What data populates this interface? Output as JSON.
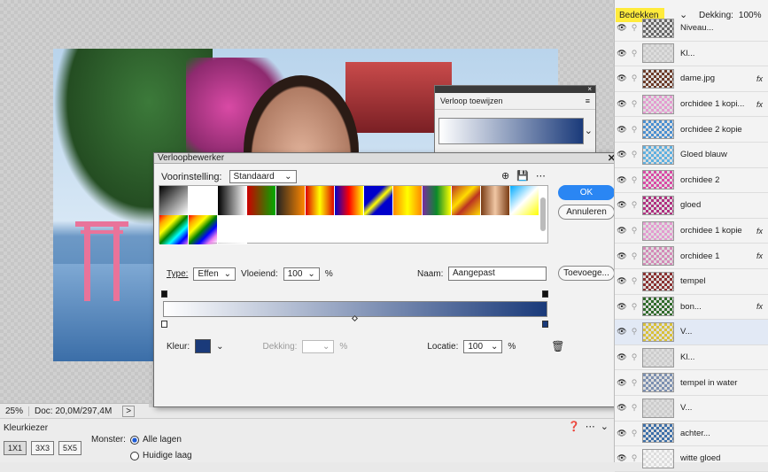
{
  "status": {
    "zoom": "25%",
    "doc": "Doc: 20,0M/297,4M",
    "arrow": ">"
  },
  "color_picker": {
    "title": "Kleurkiezer",
    "sizes": [
      "1X1",
      "3X3",
      "5X5"
    ],
    "monster_label": "Monster:",
    "options": [
      "Alle lagen",
      "Huidige laag"
    ]
  },
  "assign_panel": {
    "title": "Verloop toewijzen",
    "menu": "≡",
    "close": "×"
  },
  "dialog": {
    "title": "Verloopbewerker",
    "close": "✕",
    "preset_label": "Voorinstelling:",
    "preset_value": "Standaard",
    "ok": "OK",
    "cancel": "Annuleren",
    "add": "Toevoege...",
    "type_label": "Type:",
    "type_value": "Effen",
    "smooth_label": "Vloeiend:",
    "smooth_value": "100",
    "pct": "%",
    "name_label": "Naam:",
    "name_value": "Aangepast",
    "color_label": "Kleur:",
    "opacity_label": "Dekking:",
    "location_label": "Locatie:",
    "location_value": "100",
    "presets": [
      "linear-gradient(135deg,#000,#fff)",
      "linear-gradient(135deg,#ffffff,rgba(255,255,255,0))",
      "linear-gradient(to right,#000,#fff)",
      "linear-gradient(to right,#c00,#0a0)",
      "linear-gradient(to right,#222,#f80)",
      "linear-gradient(to right,#d00,#ff0,#d00)",
      "linear-gradient(to right,#00c,#f00,#ff0)",
      "linear-gradient(135deg,#00c 35%,#ff0 50%,#00c 65%)",
      "linear-gradient(to right,#f80,#ff0,#f80)",
      "linear-gradient(to right,#7a2ba1,#0a8a2a,#ff0)",
      "linear-gradient(135deg,#b32,#fd0 40%,#b32 60%,#fd0)",
      "linear-gradient(to right,#7a3c14,#f1c7a5,#7a3c14)",
      "linear-gradient(135deg,#0af,#fff 50%,#ff0)",
      "linear-gradient(135deg,red,orange,yellow,green,cyan,blue,violet)",
      "linear-gradient(135deg,red,orange,yellow,green,blue,violet,rgba(255,255,255,0))",
      "linear-gradient(135deg,rgba(255,255,255,0),#fff)"
    ],
    "swatch_color": "#1a3a7a"
  },
  "layers": {
    "blend_mode": "Bedekken",
    "opacity_label": "Dekking:",
    "opacity_value": "100%",
    "items": [
      {
        "name": "Niveau...",
        "fx": ""
      },
      {
        "name": "Kl...",
        "fx": ""
      },
      {
        "name": "dame.jpg",
        "fx": "fx"
      },
      {
        "name": "orchidee 1 kopi...",
        "fx": "fx"
      },
      {
        "name": "orchidee 2 kopie",
        "fx": ""
      },
      {
        "name": "Gloed blauw",
        "fx": ""
      },
      {
        "name": "orchidee 2",
        "fx": ""
      },
      {
        "name": "gloed",
        "fx": ""
      },
      {
        "name": "orchidee 1 kopie",
        "fx": "fx"
      },
      {
        "name": "orchidee 1",
        "fx": "fx"
      },
      {
        "name": "tempel",
        "fx": ""
      },
      {
        "name": "bon...",
        "fx": "fx"
      },
      {
        "name": "V...",
        "fx": ""
      },
      {
        "name": "Kl...",
        "fx": ""
      },
      {
        "name": "tempel in water",
        "fx": ""
      },
      {
        "name": "V...",
        "fx": ""
      },
      {
        "name": "achter...",
        "fx": ""
      },
      {
        "name": "witte gloed",
        "fx": ""
      }
    ]
  }
}
